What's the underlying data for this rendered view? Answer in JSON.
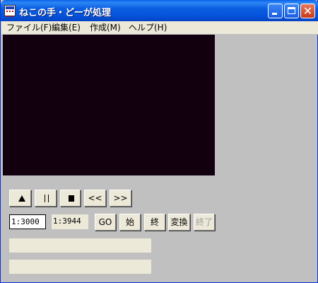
{
  "window": {
    "title": "ねこの手・どーが処理"
  },
  "menu": [
    "ファイル(F)",
    "編集(E)",
    "作成(M)",
    "ヘルプ(H)"
  ],
  "transport": {
    "rewind_label": "<<",
    "forward_label": ">>"
  },
  "controls": {
    "ratio_input": "1:3000",
    "ratio_readout": "1:3944",
    "go_label": "GO",
    "start_label": "始",
    "end_label": "終",
    "convert_label": "変換",
    "finish_label": "終了"
  },
  "titlebar_buttons": {
    "close_glyph": "✕"
  }
}
